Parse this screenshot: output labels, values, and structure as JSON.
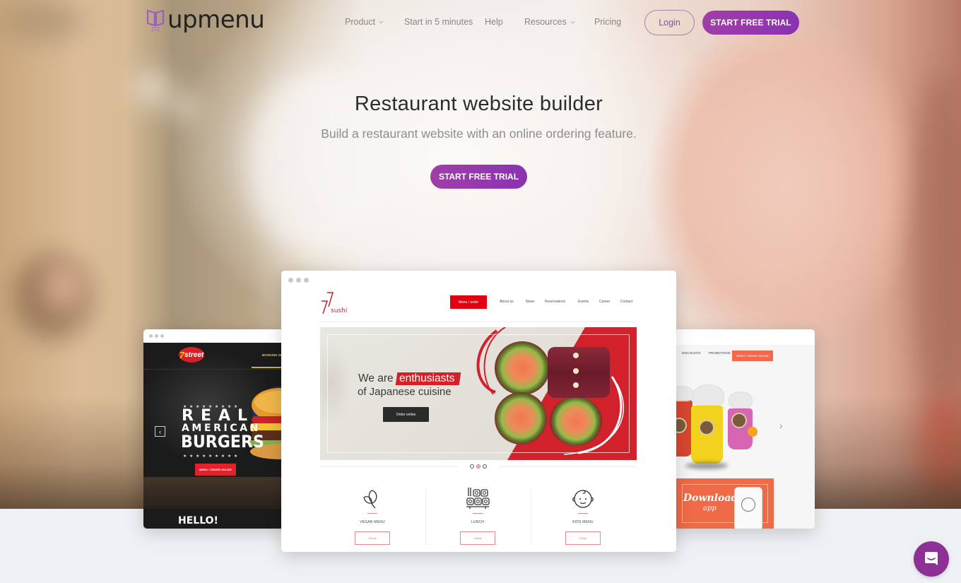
{
  "brand": {
    "name": "upmenu",
    "accent_color": "#8e2f96",
    "gradient_start": "#a03fa8",
    "gradient_end": "#8a32b0"
  },
  "nav": {
    "items": [
      {
        "label": "Product",
        "has_dropdown": true
      },
      {
        "label": "Start in 5 minutes",
        "has_dropdown": false
      },
      {
        "label": "Help",
        "has_dropdown": false
      },
      {
        "label": "Resources",
        "has_dropdown": true
      },
      {
        "label": "Pricing",
        "has_dropdown": false
      }
    ],
    "login_label": "Login",
    "trial_label": "START FREE TRIAL"
  },
  "hero": {
    "title": "Restaurant website builder",
    "subtitle": "Build a restaurant website with an online ordering feature.",
    "cta_label": "START FREE TRIAL"
  },
  "mockups": {
    "left": {
      "logo_main": "7",
      "logo_text": "street",
      "nav_label": "BOOKING ONLINE",
      "headline_1": "REAL",
      "headline_2": "AMERICAN",
      "headline_3": "BURGERS",
      "stars": "★★★★★★★★★",
      "cta_label": "MENU / ORDER ONLINE",
      "prev_icon": "‹",
      "footer_text": "HELLO!"
    },
    "center": {
      "logo_top": "77",
      "logo_text": "sushi",
      "menu_button": "Menu / order",
      "nav_items": [
        "About us",
        "News",
        "Reservations",
        "Events",
        "Career",
        "Contact"
      ],
      "banner_prefix": "We are",
      "banner_highlight": "enthusiasts",
      "banner_line2": "of Japanese cuisine",
      "banner_cta": "Order online",
      "carousel_active_index": 1,
      "carousel_count": 3,
      "features": [
        {
          "label": "VEGAN MENU",
          "icon": "leaf-icon",
          "button": "Check"
        },
        {
          "label": "LUNCH",
          "icon": "sushi-icon",
          "button": "Check"
        },
        {
          "label": "KIDS MENU",
          "icon": "baby-face-icon",
          "button": "Check"
        }
      ]
    },
    "right": {
      "nav_items": [
        "DISCOUNTS",
        "PROMOTIONS"
      ],
      "order_button": "MENU / ORDER ONLINE",
      "next_icon": "›",
      "download_title": "Download",
      "download_sub": "app"
    }
  },
  "chat": {
    "icon": "chat-icon"
  }
}
